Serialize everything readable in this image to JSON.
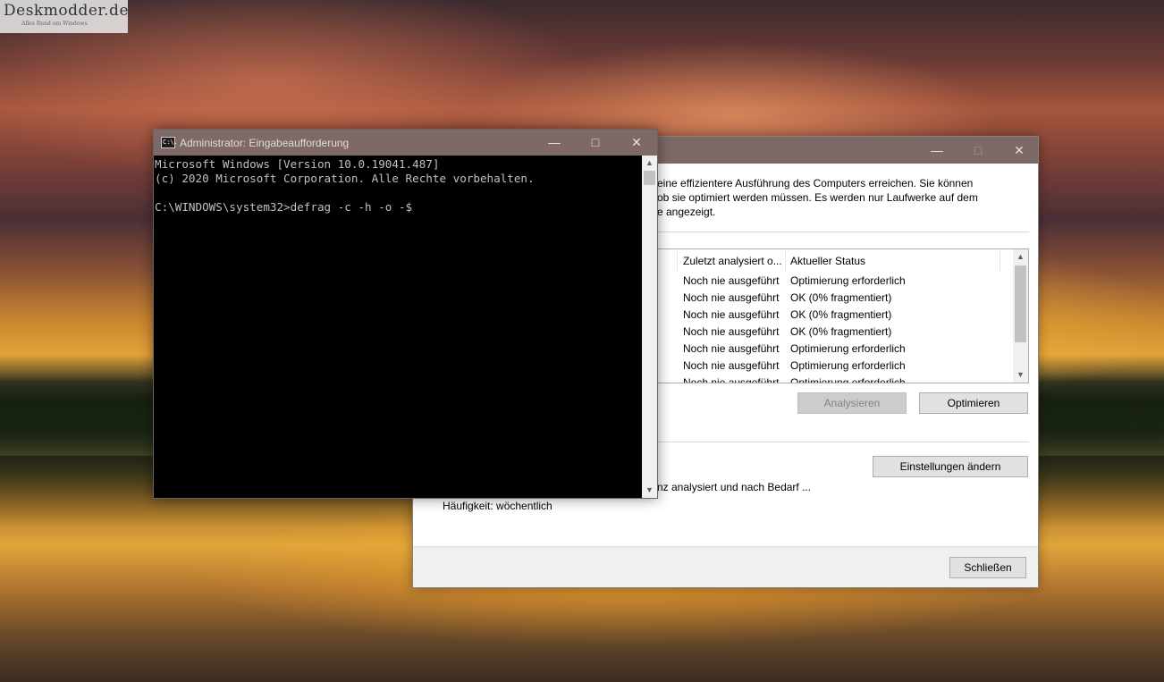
{
  "watermark": {
    "title": "Deskmodder.de",
    "subtitle": "Alles Rund um Windows"
  },
  "cmd": {
    "title": "Administrator: Eingabeaufforderung",
    "icon_label": "C:\\.",
    "lines": [
      "Microsoft Windows [Version 10.0.19041.487]",
      "(c) 2020 Microsoft Corporation. Alle Rechte vorbehalten.",
      "",
      "C:\\WINDOWS\\system32>defrag -c -h -o -$"
    ]
  },
  "dialog": {
    "description": "eine effizientere Ausführung des Computers erreichen. Sie können ob sie optimiert werden müssen. Es werden nur Laufwerke auf dem e angezeigt.",
    "desc_lines": [
      "eine effizientere Ausführung des Computers erreichen. Sie können",
      "ob sie optimiert werden müssen. Es werden nur Laufwerke auf dem",
      "e angezeigt."
    ],
    "columns": [
      "Zuletzt analysiert o...",
      "Aktueller Status"
    ],
    "rows": [
      {
        "last_analyzed": "Noch nie ausgeführt",
        "status": "Optimierung erforderlich"
      },
      {
        "last_analyzed": "Noch nie ausgeführt",
        "status": "OK (0% fragmentiert)"
      },
      {
        "last_analyzed": "Noch nie ausgeführt",
        "status": "OK (0% fragmentiert)"
      },
      {
        "last_analyzed": "Noch nie ausgeführt",
        "status": "OK (0% fragmentiert)"
      },
      {
        "last_analyzed": "Noch nie ausgeführt",
        "status": "Optimierung erforderlich"
      },
      {
        "last_analyzed": "Noch nie ausgeführt",
        "status": "Optimierung erforderlich"
      },
      {
        "last_analyzed": "Noch nie ausgeführt",
        "status": "Optimierung erforderlich"
      }
    ],
    "buttons": {
      "analyze": "Analysieren",
      "optimize": "Optimieren",
      "change_settings": "Einstellungen ändern",
      "close": "Schließen"
    },
    "schedule_text": "nz analysiert und nach Bedarf ...",
    "frequency": "Häufigkeit: wöchentlich"
  }
}
